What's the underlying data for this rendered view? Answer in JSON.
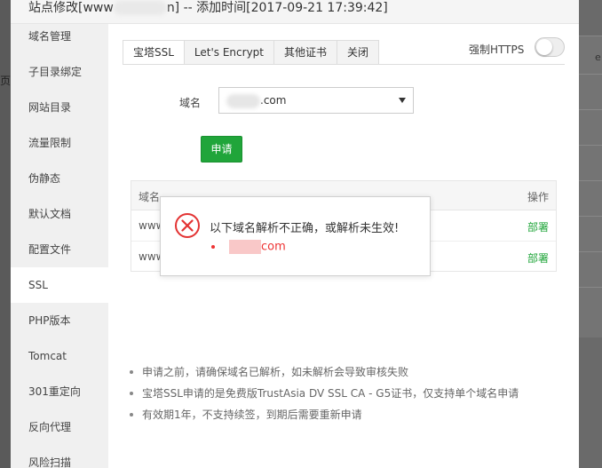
{
  "background": {
    "left_fragment": "页",
    "right_fragment": "e"
  },
  "modal": {
    "title_prefix": "站点修改[www",
    "title_suffix": "n] -- 添加时间[2017-09-21 17:39:42]"
  },
  "sidebar": {
    "items": [
      {
        "label": "域名管理"
      },
      {
        "label": "子目录绑定"
      },
      {
        "label": "网站目录"
      },
      {
        "label": "流量限制"
      },
      {
        "label": "伪静态"
      },
      {
        "label": "默认文档"
      },
      {
        "label": "配置文件"
      },
      {
        "label": "SSL"
      },
      {
        "label": "PHP版本"
      },
      {
        "label": "Tomcat"
      },
      {
        "label": "301重定向"
      },
      {
        "label": "反向代理"
      },
      {
        "label": "风险扫描"
      }
    ],
    "active_index": 7
  },
  "tabs": [
    {
      "label": "宝塔SSL"
    },
    {
      "label": "Let's Encrypt"
    },
    {
      "label": "其他证书"
    },
    {
      "label": "关闭"
    }
  ],
  "https": {
    "label": "强制HTTPS"
  },
  "form": {
    "domain_label": "域名",
    "domain_value_suffix": ".com",
    "apply_label": "申请"
  },
  "table": {
    "columns": {
      "domain": "域名",
      "action": "操作"
    },
    "rows": [
      {
        "domain": "www",
        "action": "部署"
      },
      {
        "domain": "www",
        "action": "部署"
      }
    ]
  },
  "notes": [
    "申请之前，请确保域名已解析，如未解析会导致审核失败",
    "宝塔SSL申请的是免费版TrustAsia DV SSL CA - G5证书，仅支持单个域名申请",
    "有效期1年，不支持续签，到期后需要重新申请"
  ],
  "error_popup": {
    "message": "以下域名解析不正确，或解析未生效!",
    "domain_suffix": "com"
  },
  "colors": {
    "accent_green": "#20a53a",
    "error_red": "#e33333"
  }
}
